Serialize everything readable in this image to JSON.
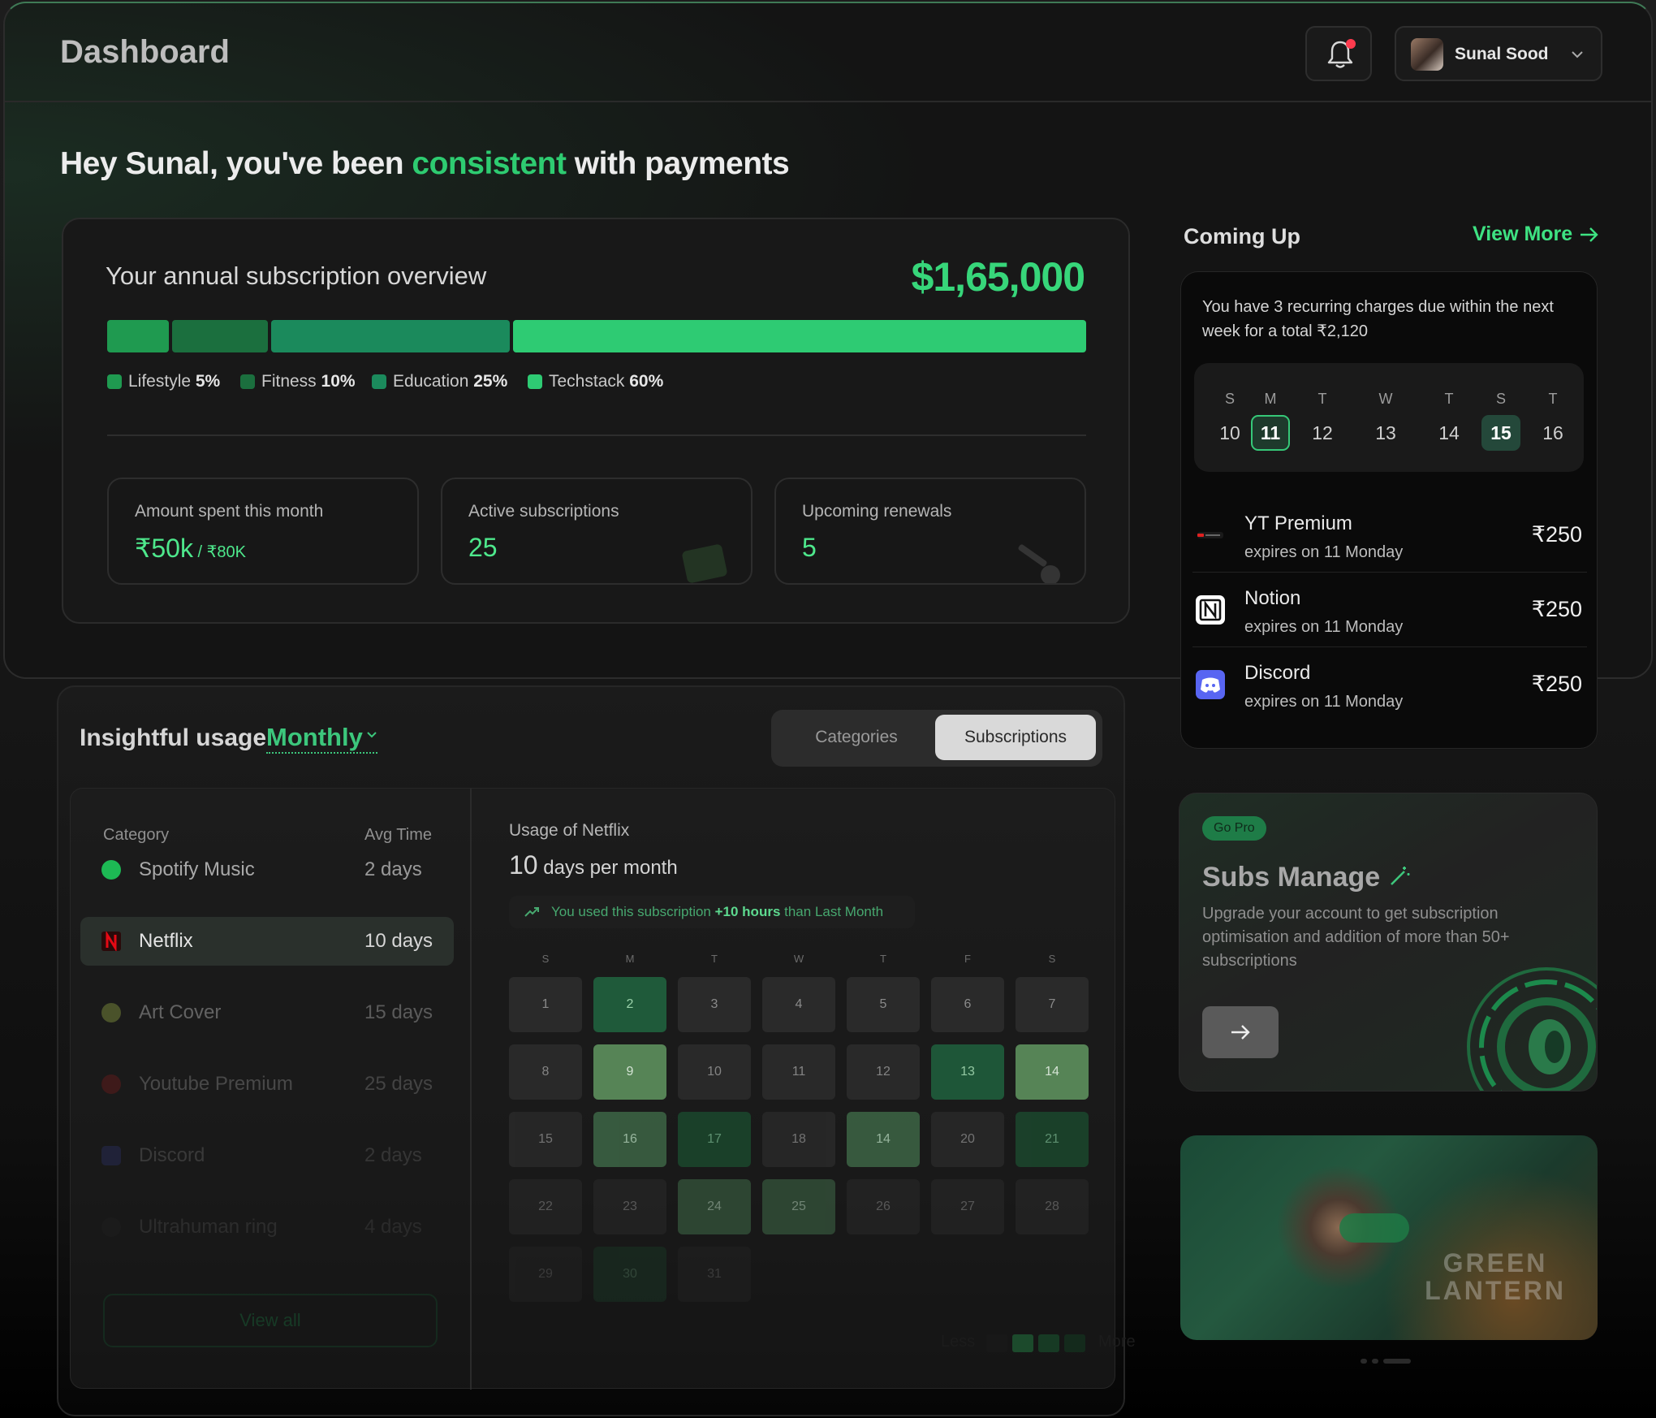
{
  "header": {
    "title": "Dashboard",
    "user_name": "Sunal Sood"
  },
  "greeting": {
    "before": "Hey Sunal, you've been ",
    "accent": "consistent",
    "after": " with payments"
  },
  "overview": {
    "title": "Your annual subscription overview",
    "total": "$1,65,000",
    "segments": [
      {
        "label": "Lifestyle",
        "pct": "5%",
        "share": 0.05,
        "color": "#1f9a50"
      },
      {
        "label": "Fitness",
        "pct": "10%",
        "share": 0.1,
        "color": "#1b6f3e"
      },
      {
        "label": "Education",
        "pct": "25%",
        "share": 0.25,
        "color": "#1b8a5c"
      },
      {
        "label": "Techstack",
        "pct": "60%",
        "share": 0.6,
        "color": "#2ecb73"
      }
    ],
    "stats": [
      {
        "label": "Amount spent this month",
        "value": "₹50k",
        "sub": " / ₹80K"
      },
      {
        "label": "Active subscriptions",
        "value": "25",
        "sub": ""
      },
      {
        "label": "Upcoming renewals",
        "value": "5",
        "sub": ""
      }
    ]
  },
  "coming_up": {
    "title": "Coming Up",
    "view_more": "View More",
    "description": "You have 3 recurring charges due within the next week for a total ₹2,120",
    "days": [
      {
        "letter": "S",
        "num": "10",
        "state": ""
      },
      {
        "letter": "M",
        "num": "11",
        "state": "sel"
      },
      {
        "letter": "T",
        "num": "12",
        "state": ""
      },
      {
        "letter": "W",
        "num": "13",
        "state": ""
      },
      {
        "letter": "T",
        "num": "14",
        "state": ""
      },
      {
        "letter": "S",
        "num": "15",
        "state": "mark"
      },
      {
        "letter": "T",
        "num": "16",
        "state": ""
      }
    ],
    "charges": [
      {
        "name": "YT Premium",
        "expires": "expires on 11 Monday",
        "amount": "₹250",
        "icon": "youtube-icon"
      },
      {
        "name": "Notion",
        "expires": "expires on 11 Monday",
        "amount": "₹250",
        "icon": "notion-icon"
      },
      {
        "name": "Discord",
        "expires": "expires on 11 Monday",
        "amount": "₹250",
        "icon": "discord-icon"
      }
    ]
  },
  "insight": {
    "title": "Insightful usage",
    "period": "Monthly",
    "tabs": [
      "Categories",
      "Subscriptions"
    ],
    "active_tab": "Subscriptions",
    "col_category": "Category",
    "col_avg": "Avg Time",
    "rows": [
      {
        "name": "Spotify Music",
        "time": "2 days",
        "icon": "spotify-icon",
        "color": "#1db954"
      },
      {
        "name": "Netflix",
        "time": "10 days",
        "icon": "netflix-icon",
        "color": "#b20710"
      },
      {
        "name": "Art Cover",
        "time": "15 days",
        "icon": "art-cover-icon",
        "color": "#7a8a3a"
      },
      {
        "name": "Youtube Premium",
        "time": "25 days",
        "icon": "youtube-icon",
        "color": "#8a1a1a"
      },
      {
        "name": "Discord",
        "time": "2 days",
        "icon": "discord-icon",
        "color": "#3c45a5"
      },
      {
        "name": "Ultrahuman ring",
        "time": "4 days",
        "icon": "ring-icon",
        "color": "#333333"
      }
    ],
    "active_row": "Netflix",
    "view_all": "View all",
    "usage_title": "Usage of Netflix",
    "usage_num": "10",
    "usage_unit": " days per month",
    "usage_note_pre": "You used this subscription ",
    "usage_note_bold": "+10 hours",
    "usage_note_post": " than Last Month",
    "weekdays": [
      "S",
      "M",
      "T",
      "W",
      "T",
      "F",
      "S"
    ],
    "calendar": [
      [
        "1",
        "2",
        "3",
        "4",
        "5",
        "6",
        "7"
      ],
      [
        "8",
        "9",
        "10",
        "11",
        "12",
        "13",
        "14"
      ],
      [
        "15",
        "16",
        "17",
        "18",
        "14",
        "20",
        "21"
      ],
      [
        "22",
        "23",
        "24",
        "25",
        "26",
        "27",
        "28"
      ],
      [
        "29",
        "30",
        "31"
      ]
    ],
    "calendar_levels": [
      [
        0,
        2,
        0,
        0,
        0,
        0,
        0
      ],
      [
        0,
        4,
        0,
        0,
        0,
        2,
        4
      ],
      [
        0,
        3,
        1,
        0,
        3,
        0,
        1
      ],
      [
        0,
        0,
        3,
        3,
        0,
        0,
        0
      ],
      [
        0,
        1,
        0
      ]
    ],
    "legend_less": "Less",
    "legend_more": "More"
  },
  "pro": {
    "badge": "Go Pro",
    "title": "Subs Manage",
    "description": "Upgrade your account to get subscription optimisation and addition of more than 50+ subscriptions"
  },
  "promo": {
    "title": "GREEN LANTERN"
  }
}
